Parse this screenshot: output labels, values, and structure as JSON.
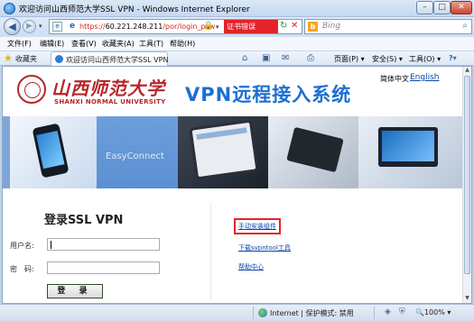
{
  "window": {
    "title": "欢迎访问山西师范大学SSL VPN - Windows Internet Explorer",
    "min_glyph": "–",
    "max_glyph": "□",
    "close_glyph": "✕"
  },
  "address_bar": {
    "url_scheme": "https://",
    "url_host": "60.221.248.211",
    "url_path": "/por/login_psw",
    "cert_error": "证书错误",
    "dropdown_glyph": "▾"
  },
  "search": {
    "placeholder": "Bing",
    "engine_glyph": "b",
    "go_glyph": "⌕"
  },
  "nav": {
    "back_glyph": "◀",
    "forward_glyph": "▶",
    "history_glyph": "▾",
    "refresh_glyph": "↻",
    "stop_glyph": "✕",
    "page_glyph": "e",
    "lock_glyph": "🔒"
  },
  "menu": [
    "文件(F)",
    "编辑(E)",
    "查看(V)",
    "收藏夹(A)",
    "工具(T)",
    "帮助(H)"
  ],
  "favorites": {
    "label": "收藏夹",
    "star_glyph": "★"
  },
  "tab": {
    "label": "欢迎访问山西师范大学SSL VPN"
  },
  "command_bar": {
    "home_glyph": "⌂",
    "feeds_glyph": "▣",
    "mail_glyph": "✉",
    "print_glyph": "⎙",
    "page": "页面(P) ▾",
    "safety": "安全(S) ▾",
    "tools": "工具(O) ▾",
    "help": "?▾"
  },
  "page": {
    "university_cn": "山西师范大学",
    "university_en": "SHANXI NORMAL UNIVERSITY",
    "system_title": "VPN远程接入系统",
    "lang_cn": "简体中文",
    "lang_en": "English",
    "banner_text": "EasyConnect"
  },
  "login": {
    "title": "登录SSL VPN",
    "username_label": "用户名:",
    "password_label": "密　码:",
    "submit": "登 录"
  },
  "links": [
    "手动安装组件",
    "下载svpntool工具",
    "帮助中心"
  ],
  "scrollbar": {
    "up_glyph": "▲",
    "down_glyph": "▼"
  },
  "status_bar": {
    "zone": "Internet | 保护模式: 禁用",
    "zoom": "🔍100%  ▾",
    "icon_a": "◈",
    "icon_b": "⛨"
  }
}
